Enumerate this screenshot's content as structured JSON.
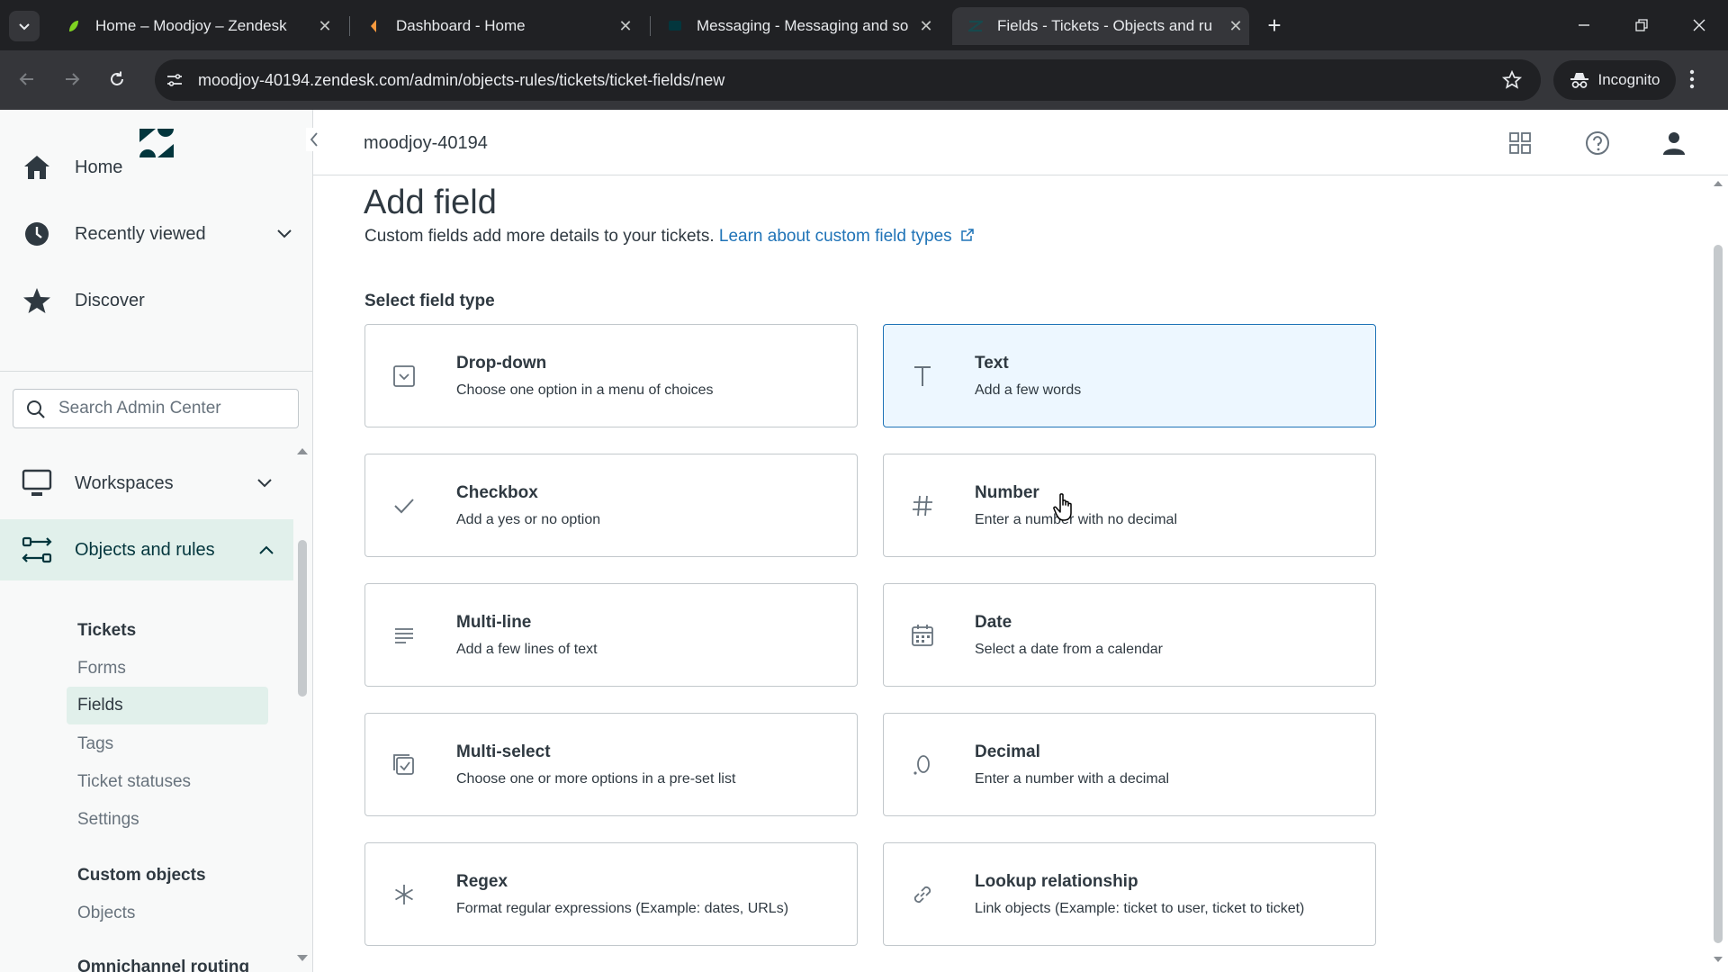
{
  "browser": {
    "tabs": [
      {
        "label": "Home – Moodjoy – Zendesk",
        "favicon": "zendesk-leaf-icon"
      },
      {
        "label": "Dashboard - Home",
        "favicon": "dashboard-favicon"
      },
      {
        "label": "Messaging - Messaging and so",
        "favicon": "messaging-favicon"
      },
      {
        "label": "Fields - Tickets - Objects and ru",
        "favicon": "zendesk-admin-favicon"
      }
    ],
    "active_tab_index": 3,
    "url": "moodjoy-40194.zendesk.com/admin/objects-rules/tickets/ticket-fields/new",
    "incognito_label": "Incognito"
  },
  "sidebar": {
    "nav": [
      {
        "label": "Home",
        "icon": "home-icon"
      },
      {
        "label": "Recently viewed",
        "icon": "clock-icon"
      },
      {
        "label": "Discover",
        "icon": "star-icon"
      }
    ],
    "search_placeholder": "Search Admin Center",
    "sections": [
      {
        "label": "Workspaces",
        "icon": "monitor-icon",
        "expanded": false
      },
      {
        "label": "Objects and rules",
        "icon": "objects-rules-icon",
        "expanded": true
      }
    ],
    "tickets_heading": "Tickets",
    "ticket_items": [
      "Forms",
      "Fields",
      "Tags",
      "Ticket statuses",
      "Settings"
    ],
    "active_ticket_item": "Fields",
    "custom_objects_heading": "Custom objects",
    "custom_object_items": [
      "Objects"
    ],
    "partial_heading": "Omnichannel routing"
  },
  "topbar": {
    "account": "moodjoy-40194"
  },
  "page": {
    "title": "Add field",
    "description": "Custom fields add more details to your tickets.",
    "learn_link": "Learn about custom field types",
    "select_label": "Select field type"
  },
  "field_types": [
    {
      "title": "Drop-down",
      "desc": "Choose one option in a menu of choices",
      "icon": "dropdown-icon"
    },
    {
      "title": "Text",
      "desc": "Add a few words",
      "icon": "text-icon"
    },
    {
      "title": "Checkbox",
      "desc": "Add a yes or no option",
      "icon": "checkmark-icon"
    },
    {
      "title": "Number",
      "desc": "Enter a number with no decimal",
      "icon": "hash-icon"
    },
    {
      "title": "Multi-line",
      "desc": "Add a few lines of text",
      "icon": "multiline-icon"
    },
    {
      "title": "Date",
      "desc": "Select a date from a calendar",
      "icon": "calendar-icon"
    },
    {
      "title": "Multi-select",
      "desc": "Choose one or more options in a pre-set list",
      "icon": "multiselect-icon"
    },
    {
      "title": "Decimal",
      "desc": "Enter a number with a decimal",
      "icon": "decimal-icon"
    },
    {
      "title": "Regex",
      "desc": "Format regular expressions (Example: dates, URLs)",
      "icon": "asterisk-icon"
    },
    {
      "title": "Lookup relationship",
      "desc": "Link objects (Example: ticket to user, ticket to ticket)",
      "icon": "link-icon"
    }
  ],
  "hovered_field": "Text",
  "colors": {
    "accent_link": "#1f73b7",
    "active_nav_bg": "#e1f0eb",
    "hover_card_bg": "#edf7ff",
    "text_primary": "#2f3941"
  }
}
